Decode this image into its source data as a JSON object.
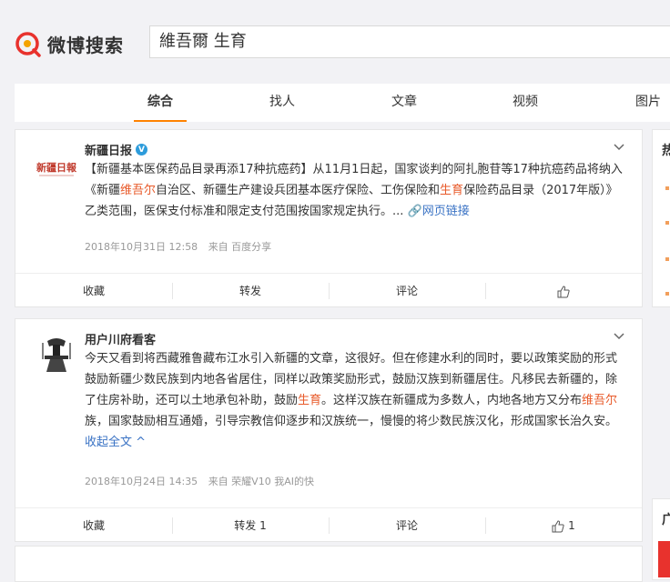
{
  "app": {
    "logo_text": "微博搜索"
  },
  "search": {
    "query": "維吾爾 生育"
  },
  "tabs": [
    {
      "label": "综合",
      "active": true
    },
    {
      "label": "找人"
    },
    {
      "label": "文章"
    },
    {
      "label": "视频"
    },
    {
      "label": "图片"
    }
  ],
  "posts": [
    {
      "author": "新疆日报",
      "avatar_text": "新疆日报",
      "verified": true,
      "content_parts": [
        {
          "text": "【新疆基本医保药品目录再添17种抗癌药】从11月1日起，国家谈判的阿扎胞苷等17种抗癌药品将纳入《新疆",
          "hl": false
        },
        {
          "text": "维吾尔",
          "hl": true
        },
        {
          "text": "自治区、新疆生产建设兵团基本医疗保险、工伤保险和",
          "hl": false
        },
        {
          "text": "生育",
          "hl": true
        },
        {
          "text": "保险药品目录（2017年版）》乙类范围，医保支付标准和限定支付范围按国家规定执行。... ",
          "hl": false
        }
      ],
      "link_label": "网页链接",
      "time": "2018年10月31日 12:58",
      "source": "来自 百度分享",
      "actions": {
        "favorite": "收藏",
        "repost": "转发",
        "comment": "评论",
        "like": ""
      }
    },
    {
      "author": "用户川府看客",
      "verified": false,
      "content_parts": [
        {
          "text": "今天又看到将西藏雅鲁藏布江水引入新疆的文章，这很好。但在修建水利的同时，要以政策奖励的形式鼓励新疆少数民族到内地各省居住，同样以政策奖励形式，鼓励汉族到新疆居住。凡移民去新疆的，除了住房补助，还可以土地承包补助，鼓励",
          "hl": false
        },
        {
          "text": "生育",
          "hl": true
        },
        {
          "text": "。这样汉族在新疆成为多数人，内地各地方又分布",
          "hl": false
        },
        {
          "text": "维吾尔",
          "hl": true
        },
        {
          "text": "族，国家鼓励相互通婚，引导宗教信仰逐步和汉族统一，慢慢的将少数民族汉化，形成国家长治久安。 ",
          "hl": false
        }
      ],
      "link_label": "收起全文",
      "time": "2018年10月24日 14:35",
      "source": "来自 荣耀V10 我AI的快",
      "actions": {
        "favorite": "收藏",
        "repost": "转发 1",
        "comment": "评论",
        "like": "1"
      }
    }
  ],
  "sidebar": {
    "title1": "热",
    "title2": "广"
  },
  "colors": {
    "accent": "#ff8200",
    "highlight": "#e85a2a",
    "link": "#3972c4",
    "verified": "#2d9cdb"
  }
}
